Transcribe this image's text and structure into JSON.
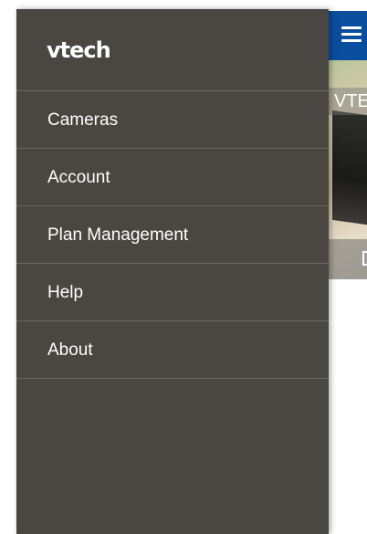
{
  "background_app": {
    "camera_label": "VTE"
  },
  "drawer": {
    "logo": "vtech",
    "items": [
      {
        "label": "Cameras"
      },
      {
        "label": "Account"
      },
      {
        "label": "Plan Management"
      },
      {
        "label": "Help"
      },
      {
        "label": "About"
      }
    ]
  },
  "colors": {
    "drawer_bg": "#4a4641",
    "divider": "#6b6661",
    "app_bar": "#0a4d9c",
    "text": "#ffffff"
  },
  "icons": {
    "menu": "hamburger-menu-icon"
  }
}
